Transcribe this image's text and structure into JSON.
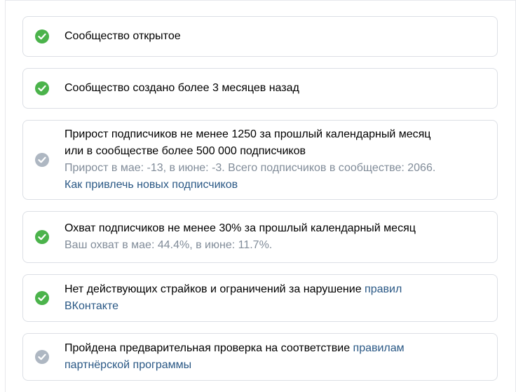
{
  "requirements": [
    {
      "status": "done",
      "icon": "check-circle-icon",
      "title": "Сообщество открытое"
    },
    {
      "status": "done",
      "icon": "check-circle-icon",
      "title": "Сообщество создано более 3 месяцев назад"
    },
    {
      "status": "pending",
      "icon": "check-circle-icon",
      "title_line1": "Прирост подписчиков не менее 1250 за прошлый календарный месяц",
      "title_line2": "или в сообществе более 500 000 подписчиков",
      "note": "Прирост в мае: -13, в июне: -3. Всего подписчиков в сообществе: 2066.",
      "link": "Как привлечь новых подписчиков"
    },
    {
      "status": "done",
      "icon": "check-circle-icon",
      "title": "Охват подписчиков не менее 30% за прошлый календарный месяц",
      "note": "Ваш охват в мае: 44.4%, в июне: 11.7%."
    },
    {
      "status": "done",
      "icon": "check-circle-icon",
      "title_prefix": "Нет действующих страйков и ограничений за нарушение ",
      "link_part1": "правил",
      "link_part2": "ВКонтакте"
    },
    {
      "status": "pending",
      "icon": "check-circle-icon",
      "title_prefix": "Пройдена предварительная проверка на соответствие ",
      "link_part1": "правилам",
      "link_part2": "партнёрской программы"
    }
  ],
  "colors": {
    "done": "#4bb34b",
    "pending": "#aeb7c2",
    "link": "#2a5885",
    "note": "#818c99",
    "border": "#dcdfe5"
  }
}
